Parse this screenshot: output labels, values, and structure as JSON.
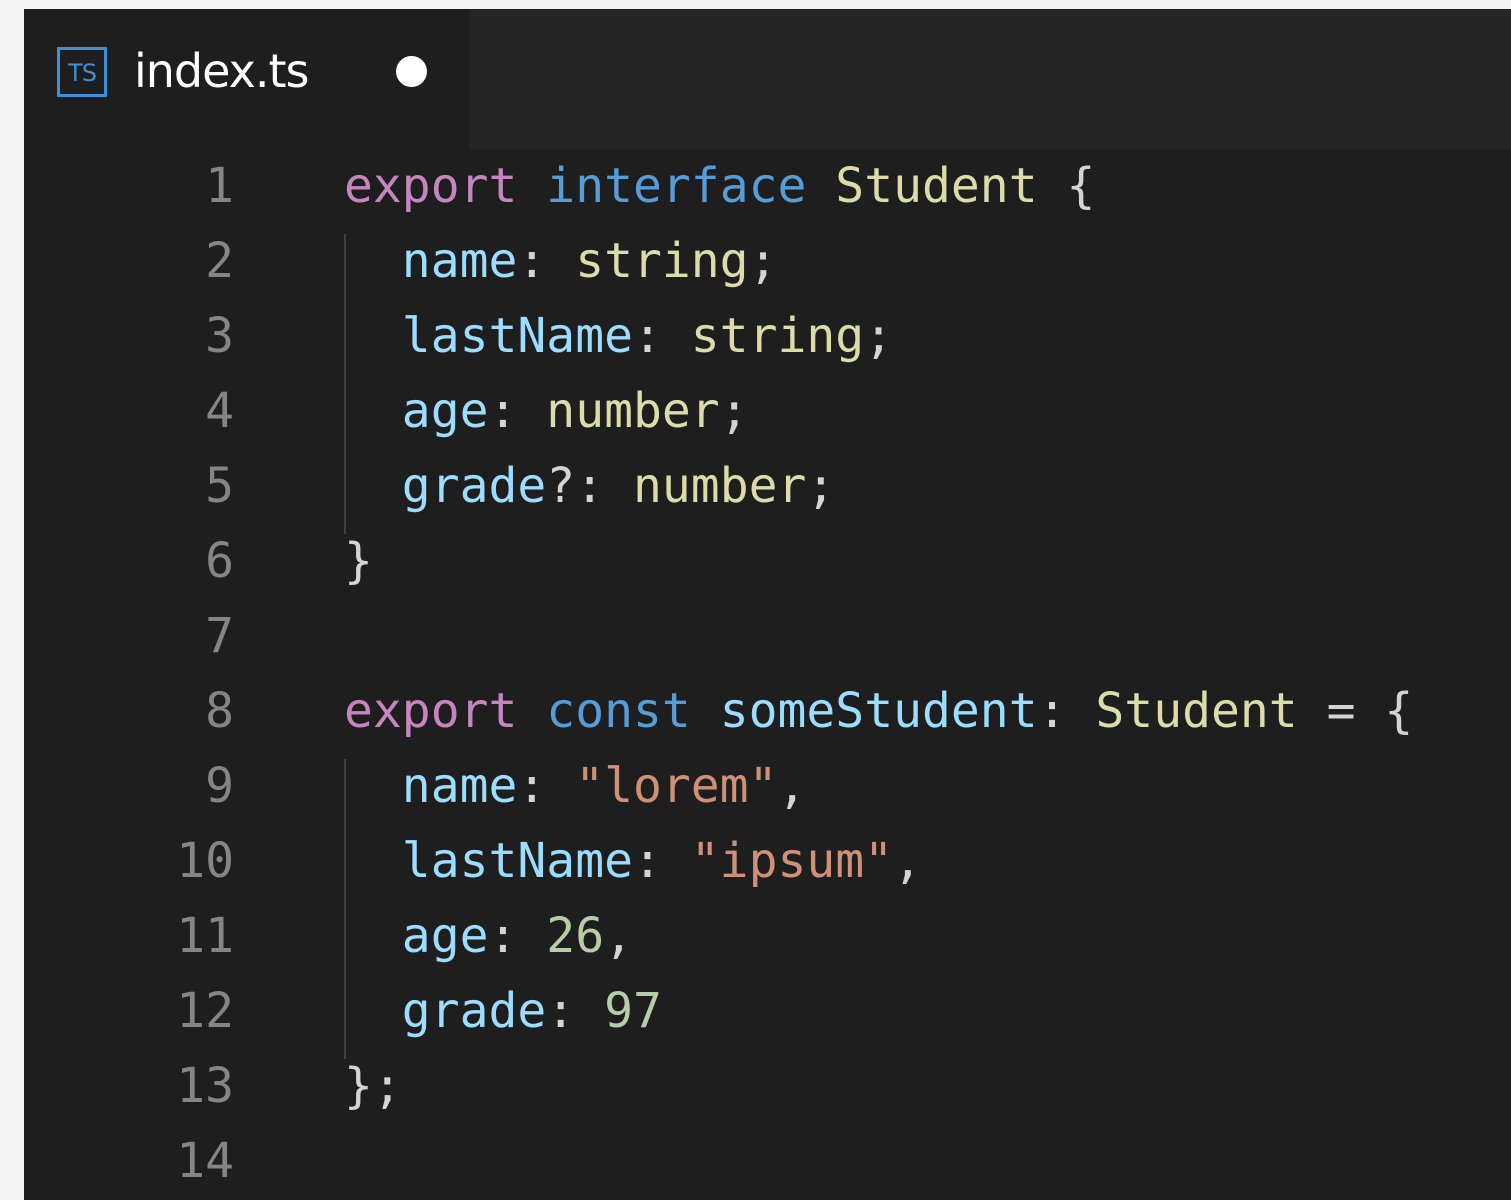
{
  "tab": {
    "icon_text": "TS",
    "file_name": "index.ts",
    "modified": true
  },
  "colors": {
    "keyword_export": "#c586c0",
    "keyword_blue": "#569cd6",
    "type": "#dcdcaa",
    "property": "#9cdcfe",
    "string": "#ce9178",
    "number": "#b5cea8"
  },
  "lines": [
    {
      "n": "1",
      "tokens": [
        [
          "export",
          "kw-export"
        ],
        [
          " ",
          "punc"
        ],
        [
          "interface",
          "kw-blue"
        ],
        [
          " ",
          "punc"
        ],
        [
          "Student",
          "type"
        ],
        [
          " {",
          "punc"
        ]
      ]
    },
    {
      "n": "2",
      "tokens": [
        [
          "  ",
          "punc"
        ],
        [
          "name",
          "prop"
        ],
        [
          ": ",
          "punc"
        ],
        [
          "string",
          "type"
        ],
        [
          ";",
          "punc"
        ]
      ]
    },
    {
      "n": "3",
      "tokens": [
        [
          "  ",
          "punc"
        ],
        [
          "lastName",
          "prop"
        ],
        [
          ": ",
          "punc"
        ],
        [
          "string",
          "type"
        ],
        [
          ";",
          "punc"
        ]
      ]
    },
    {
      "n": "4",
      "tokens": [
        [
          "  ",
          "punc"
        ],
        [
          "age",
          "prop"
        ],
        [
          ": ",
          "punc"
        ],
        [
          "number",
          "type"
        ],
        [
          ";",
          "punc"
        ]
      ]
    },
    {
      "n": "5",
      "tokens": [
        [
          "  ",
          "punc"
        ],
        [
          "grade",
          "prop"
        ],
        [
          "?: ",
          "punc"
        ],
        [
          "number",
          "type"
        ],
        [
          ";",
          "punc"
        ]
      ]
    },
    {
      "n": "6",
      "tokens": [
        [
          "}",
          "punc"
        ]
      ]
    },
    {
      "n": "7",
      "tokens": []
    },
    {
      "n": "8",
      "tokens": [
        [
          "export",
          "kw-export"
        ],
        [
          " ",
          "punc"
        ],
        [
          "const",
          "kw-blue"
        ],
        [
          " ",
          "punc"
        ],
        [
          "someStudent",
          "prop"
        ],
        [
          ": ",
          "punc"
        ],
        [
          "Student",
          "type"
        ],
        [
          " = {",
          "punc"
        ]
      ]
    },
    {
      "n": "9",
      "tokens": [
        [
          "  ",
          "punc"
        ],
        [
          "name",
          "prop"
        ],
        [
          ": ",
          "punc"
        ],
        [
          "\"lorem\"",
          "str"
        ],
        [
          ",",
          "punc"
        ]
      ]
    },
    {
      "n": "10",
      "tokens": [
        [
          "  ",
          "punc"
        ],
        [
          "lastName",
          "prop"
        ],
        [
          ": ",
          "punc"
        ],
        [
          "\"ipsum\"",
          "str"
        ],
        [
          ",",
          "punc"
        ]
      ]
    },
    {
      "n": "11",
      "tokens": [
        [
          "  ",
          "punc"
        ],
        [
          "age",
          "prop"
        ],
        [
          ": ",
          "punc"
        ],
        [
          "26",
          "num"
        ],
        [
          ",",
          "punc"
        ]
      ]
    },
    {
      "n": "12",
      "tokens": [
        [
          "  ",
          "punc"
        ],
        [
          "grade",
          "prop"
        ],
        [
          ": ",
          "punc"
        ],
        [
          "97",
          "num"
        ]
      ]
    },
    {
      "n": "13",
      "tokens": [
        [
          "};",
          "punc"
        ]
      ]
    },
    {
      "n": "14",
      "tokens": []
    }
  ]
}
